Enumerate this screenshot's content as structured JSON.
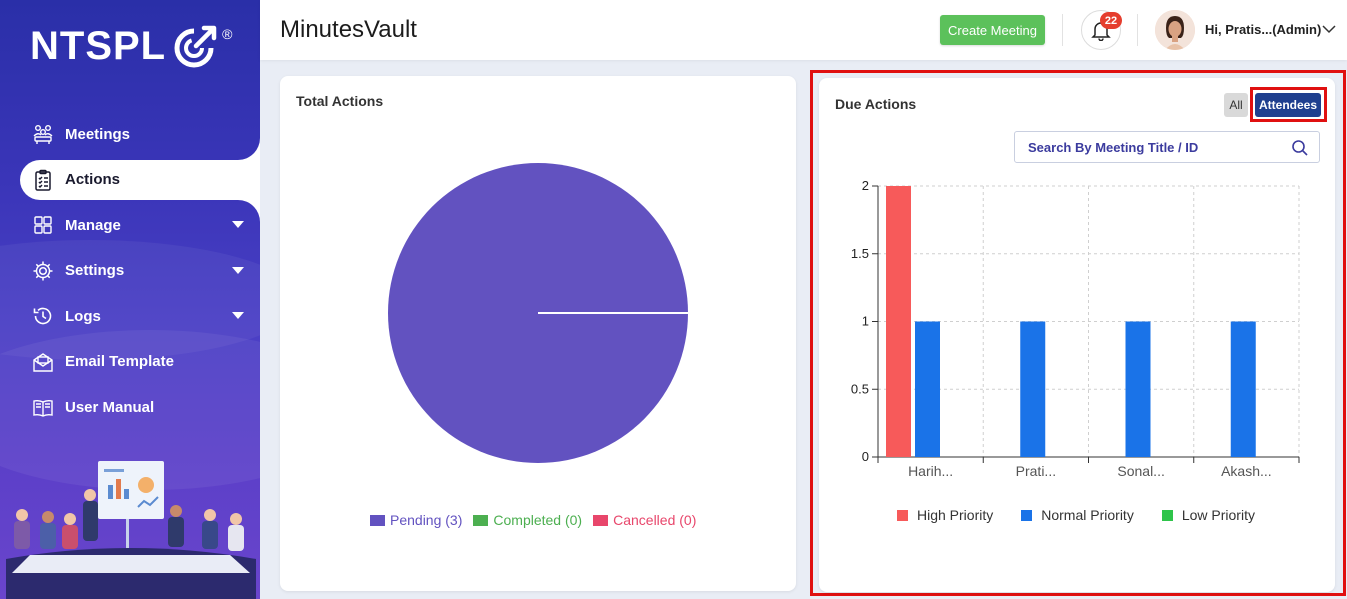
{
  "brand": {
    "logo_text": "NTSPL",
    "logo_reg": "®"
  },
  "sidebar": {
    "items": [
      {
        "label": "Meetings",
        "icon": "meetings-icon",
        "active": false,
        "has_caret": false
      },
      {
        "label": "Actions",
        "icon": "clipboard-icon",
        "active": true,
        "has_caret": false
      },
      {
        "label": "Manage",
        "icon": "grid-icon",
        "active": false,
        "has_caret": true
      },
      {
        "label": "Settings",
        "icon": "gear-icon",
        "active": false,
        "has_caret": true
      },
      {
        "label": "Logs",
        "icon": "history-icon",
        "active": false,
        "has_caret": true
      },
      {
        "label": "Email Template",
        "icon": "email-icon",
        "active": false,
        "has_caret": false
      },
      {
        "label": "User Manual",
        "icon": "book-icon",
        "active": false,
        "has_caret": false
      }
    ]
  },
  "header": {
    "title": "MinutesVault",
    "create_meeting_label": "Create Meeting",
    "notification_count": "22",
    "user_label": "Hi, Pratis...(Admin)"
  },
  "total_actions": {
    "title": "Total Actions",
    "chart_data": {
      "type": "pie",
      "title": "Total Actions",
      "slices": [
        {
          "label": "Pending",
          "value": 3,
          "color": "#6252c0"
        },
        {
          "label": "Completed",
          "value": 0,
          "color": "#4caf50"
        },
        {
          "label": "Cancelled",
          "value": 0,
          "color": "#e8466b"
        }
      ],
      "legend": [
        "Pending (3)",
        "Completed (0)",
        "Cancelled (0)"
      ],
      "legend_placement": "bottom"
    }
  },
  "due_actions": {
    "title": "Due Actions",
    "toggle_all_label": "All",
    "toggle_attendees_label": "Attendees",
    "search_placeholder": "Search By Meeting Title / ID",
    "chart_data": {
      "type": "bar",
      "categories": [
        "Harih...",
        "Prati...",
        "Sonal...",
        "Akash..."
      ],
      "series": [
        {
          "name": "High Priority",
          "color": "#f75a5a",
          "values": [
            2,
            0,
            0,
            0
          ]
        },
        {
          "name": "Normal Priority",
          "color": "#1a73e8",
          "values": [
            1,
            1,
            1,
            1
          ]
        },
        {
          "name": "Low Priority",
          "color": "#2ec44a",
          "values": [
            0,
            0,
            0,
            0
          ]
        }
      ],
      "ylim": [
        0,
        2
      ],
      "yticks": [
        "0",
        "0.5",
        "1",
        "1.5",
        "2"
      ],
      "grid": true,
      "legend_placement": "bottom"
    }
  }
}
